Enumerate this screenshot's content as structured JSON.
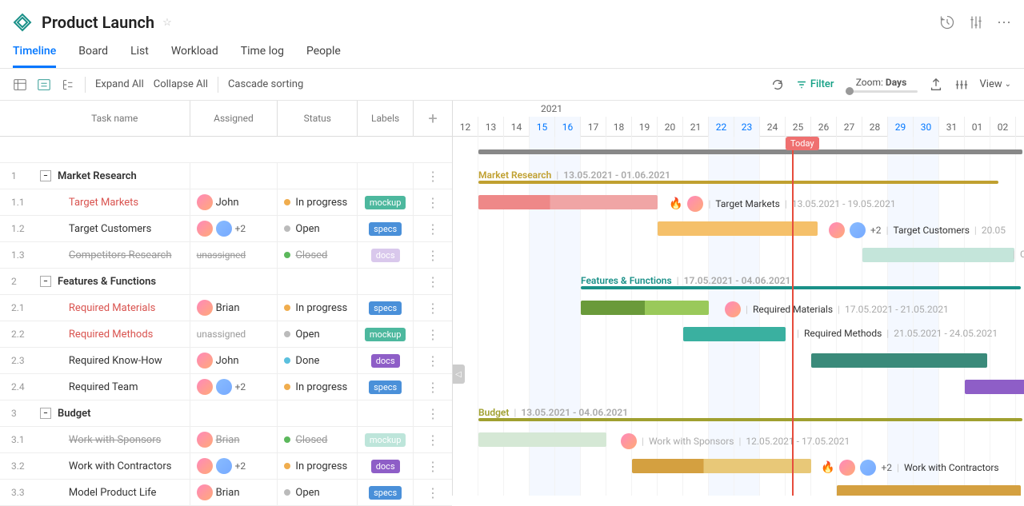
{
  "header": {
    "title": "Product Launch"
  },
  "tabs": [
    "Timeline",
    "Board",
    "List",
    "Workload",
    "Time log",
    "People"
  ],
  "active_tab": "Timeline",
  "toolbar": {
    "expand_all": "Expand All",
    "collapse_all": "Collapse All",
    "cascade_sorting": "Cascade sorting",
    "filter": "Filter",
    "zoom_label": "Zoom:",
    "zoom_value": "Days",
    "view": "View"
  },
  "columns": {
    "task_name": "Task name",
    "assigned": "Assigned",
    "status": "Status",
    "labels": "Labels"
  },
  "timeline": {
    "year": "2021",
    "days": [
      {
        "d": "12",
        "weekend": false
      },
      {
        "d": "13",
        "weekend": false
      },
      {
        "d": "14",
        "weekend": false
      },
      {
        "d": "15",
        "weekend": true
      },
      {
        "d": "16",
        "weekend": true
      },
      {
        "d": "17",
        "weekend": false
      },
      {
        "d": "18",
        "weekend": false
      },
      {
        "d": "19",
        "weekend": false
      },
      {
        "d": "20",
        "weekend": false
      },
      {
        "d": "21",
        "weekend": false
      },
      {
        "d": "22",
        "weekend": true
      },
      {
        "d": "23",
        "weekend": true
      },
      {
        "d": "24",
        "weekend": false
      },
      {
        "d": "25",
        "weekend": false
      },
      {
        "d": "26",
        "weekend": false
      },
      {
        "d": "27",
        "weekend": false
      },
      {
        "d": "28",
        "weekend": false
      },
      {
        "d": "29",
        "weekend": true
      },
      {
        "d": "30",
        "weekend": true
      },
      {
        "d": "31",
        "weekend": false
      },
      {
        "d": "01",
        "weekend": false
      },
      {
        "d": "02",
        "weekend": false
      }
    ],
    "today": "Today"
  },
  "status_colors": {
    "in_progress": "#f0ad4e",
    "open": "#bbb",
    "closed": "#5cb85c",
    "done": "#5bc0de"
  },
  "label_colors": {
    "mockup": "#4db89e",
    "specs": "#4a90d9",
    "docs": "#8e5ec7",
    "mockup_faded": "#bde5da",
    "docs_faded": "#d9c8ec"
  },
  "rows": [
    {
      "num": "1",
      "type": "group",
      "name": "Market Research",
      "bar_title": "Market Research",
      "bar_dates": "13.05.2021 - 01.06.2021",
      "bar_color": "#c0a030"
    },
    {
      "num": "1.1",
      "type": "task",
      "name": "Target Markets",
      "red": true,
      "assignee": "John",
      "avatars": 1,
      "status": "In progress",
      "status_key": "in_progress",
      "label": "mockup",
      "bar_title": "Target Markets",
      "bar_dates": "13.05.2021 - 19.05.2021",
      "flame": true
    },
    {
      "num": "1.2",
      "type": "task",
      "name": "Target Customers",
      "assignee": "",
      "avatars": 2,
      "extra": "+2",
      "status": "Open",
      "status_key": "open",
      "label": "specs",
      "bar_title": "Target Customers",
      "bar_dates": "20.05"
    },
    {
      "num": "1.3",
      "type": "task",
      "name": "Competitors Research",
      "strike": true,
      "assignee": "unassigned",
      "unassigned": true,
      "strike_assigned": true,
      "status": "Closed",
      "status_key": "closed",
      "strike_status": true,
      "label": "docs",
      "label_faded": true,
      "bar_title": "Cor"
    },
    {
      "num": "2",
      "type": "group",
      "name": "Features & Functions",
      "bar_title": "Features & Functions",
      "bar_dates": "17.05.2021 - 04.06.2021",
      "bar_color": "#1a9088"
    },
    {
      "num": "2.1",
      "type": "task",
      "name": "Required Materials",
      "red": true,
      "assignee": "Brian",
      "avatars": 1,
      "status": "In progress",
      "status_key": "in_progress",
      "label": "specs",
      "bar_title": "Required Materials",
      "bar_dates": "17.05.2021 - 21.05.2021"
    },
    {
      "num": "2.2",
      "type": "task",
      "name": "Required Methods",
      "red": true,
      "assignee": "unassigned",
      "unassigned": true,
      "status": "Open",
      "status_key": "open",
      "label": "mockup",
      "bar_title": "Required Methods",
      "bar_dates": "21.05.2021 - 24.05.2021"
    },
    {
      "num": "2.3",
      "type": "task",
      "name": "Required Know-How",
      "assignee": "John",
      "avatars": 1,
      "status": "Done",
      "status_key": "done",
      "label": "docs",
      "flame": true
    },
    {
      "num": "2.4",
      "type": "task",
      "name": "Required Team",
      "assignee": "",
      "avatars": 2,
      "extra": "+2",
      "status": "In progress",
      "status_key": "in_progress",
      "label": "specs"
    },
    {
      "num": "3",
      "type": "group",
      "name": "Budget",
      "bar_title": "Budget",
      "bar_dates": "13.05.2021 - 04.06.2021",
      "bar_color": "#a0a030"
    },
    {
      "num": "3.1",
      "type": "task",
      "name": "Work with Sponsors",
      "strike": true,
      "assignee": "Brian",
      "avatars": 1,
      "strike_assigned": true,
      "status": "Closed",
      "status_key": "closed",
      "strike_status": true,
      "label": "mockup",
      "label_faded": true,
      "bar_title": "Work with Sponsors",
      "bar_dates": "12.05.2021 - 17.05.2021"
    },
    {
      "num": "3.2",
      "type": "task",
      "name": "Work with Contractors",
      "assignee": "",
      "avatars": 2,
      "extra": "+2",
      "status": "In progress",
      "status_key": "in_progress",
      "label": "docs",
      "bar_title": "Work with Contractors",
      "flame": true
    },
    {
      "num": "3.3",
      "type": "task",
      "name": "Model Product Life",
      "assignee": "Brian",
      "avatars": 1,
      "status": "Open",
      "status_key": "open",
      "label": "specs"
    }
  ]
}
